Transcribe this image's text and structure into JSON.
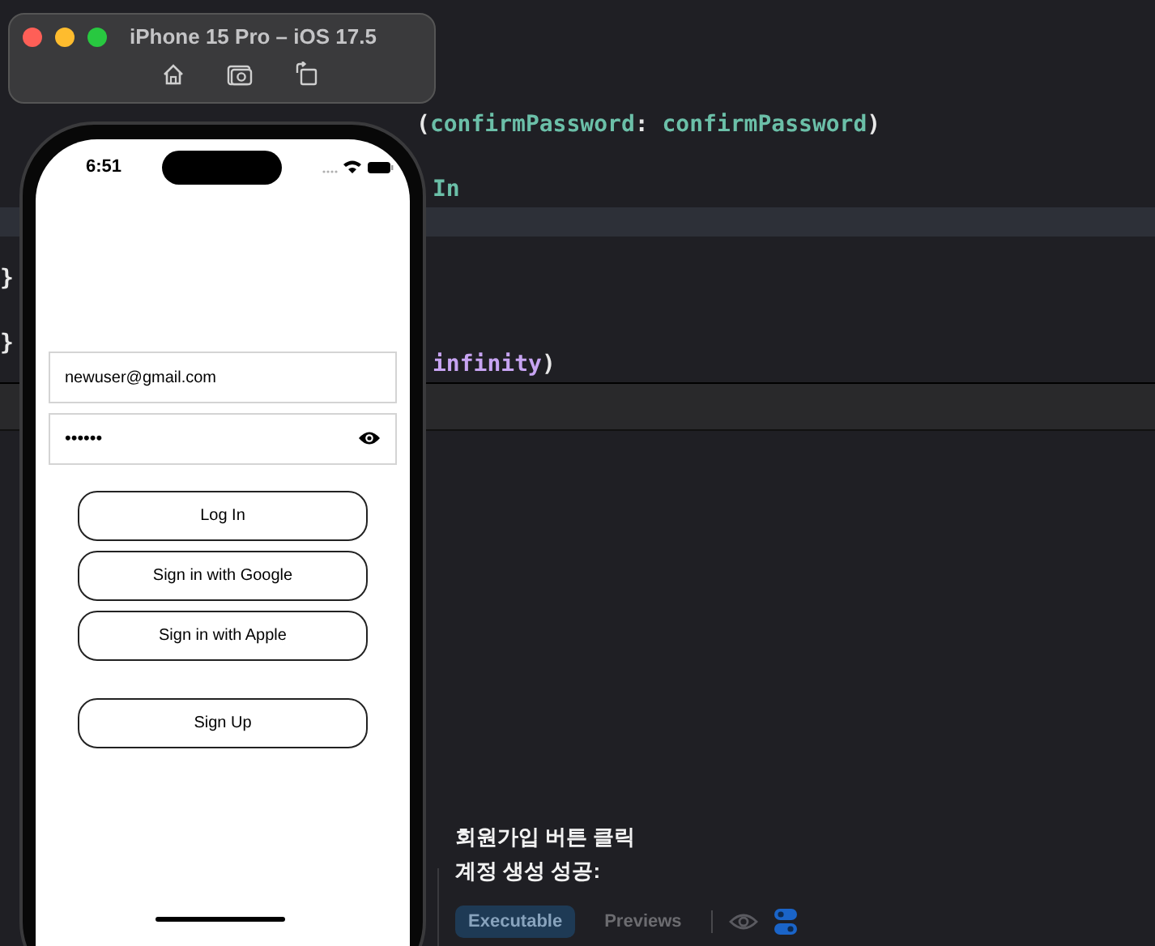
{
  "editor": {
    "code_lines": [
      {
        "segments": [
          {
            "text": "(",
            "kind": "plain"
          },
          {
            "text": "confirmPassword",
            "kind": "ident"
          },
          {
            "text": ": ",
            "kind": "plain"
          },
          {
            "text": "confirmPassword",
            "kind": "ident"
          },
          {
            "text": ")",
            "kind": "plain"
          }
        ]
      },
      {
        "segments": [
          {
            "text": "In",
            "kind": "ident"
          }
        ]
      },
      {
        "segments": [
          {
            "text": "}",
            "kind": "plain"
          }
        ]
      },
      {
        "segments": [
          {
            "text": "}",
            "kind": "plain"
          }
        ]
      },
      {
        "segments": [
          {
            "text": "infinity",
            "kind": "call"
          },
          {
            "text": ")",
            "kind": "plain"
          }
        ]
      }
    ]
  },
  "simulator": {
    "title": "iPhone 15 Pro – iOS 17.5"
  },
  "phone": {
    "status_time": "6:51",
    "email_field": {
      "value": "newuser@gmail.com"
    },
    "password_field": {
      "value": "••••••"
    },
    "buttons": [
      {
        "label": "Log In"
      },
      {
        "label": "Sign in with Google"
      },
      {
        "label": "Sign in with Apple"
      },
      {
        "label": "Sign Up"
      }
    ]
  },
  "console": {
    "lines": [
      "회원가입 버튼 클릭",
      "계정 생성 성공:"
    ]
  },
  "bottom_bar": {
    "tabs": [
      {
        "label": "Executable",
        "selected": true
      },
      {
        "label": "Previews",
        "selected": false
      }
    ]
  }
}
